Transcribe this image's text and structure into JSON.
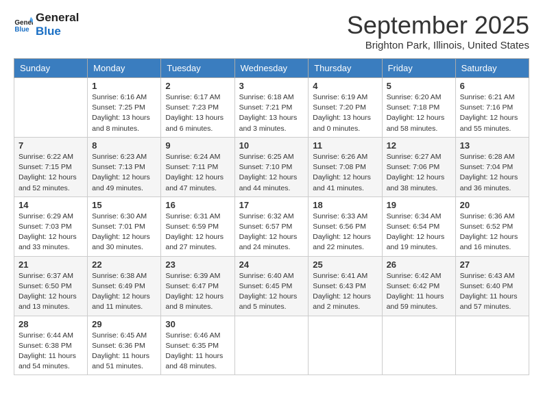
{
  "header": {
    "logo_line1": "General",
    "logo_line2": "Blue",
    "month": "September 2025",
    "location": "Brighton Park, Illinois, United States"
  },
  "weekdays": [
    "Sunday",
    "Monday",
    "Tuesday",
    "Wednesday",
    "Thursday",
    "Friday",
    "Saturday"
  ],
  "weeks": [
    [
      {
        "day": "",
        "sunrise": "",
        "sunset": "",
        "daylight": ""
      },
      {
        "day": "1",
        "sunrise": "Sunrise: 6:16 AM",
        "sunset": "Sunset: 7:25 PM",
        "daylight": "Daylight: 13 hours and 8 minutes."
      },
      {
        "day": "2",
        "sunrise": "Sunrise: 6:17 AM",
        "sunset": "Sunset: 7:23 PM",
        "daylight": "Daylight: 13 hours and 6 minutes."
      },
      {
        "day": "3",
        "sunrise": "Sunrise: 6:18 AM",
        "sunset": "Sunset: 7:21 PM",
        "daylight": "Daylight: 13 hours and 3 minutes."
      },
      {
        "day": "4",
        "sunrise": "Sunrise: 6:19 AM",
        "sunset": "Sunset: 7:20 PM",
        "daylight": "Daylight: 13 hours and 0 minutes."
      },
      {
        "day": "5",
        "sunrise": "Sunrise: 6:20 AM",
        "sunset": "Sunset: 7:18 PM",
        "daylight": "Daylight: 12 hours and 58 minutes."
      },
      {
        "day": "6",
        "sunrise": "Sunrise: 6:21 AM",
        "sunset": "Sunset: 7:16 PM",
        "daylight": "Daylight: 12 hours and 55 minutes."
      }
    ],
    [
      {
        "day": "7",
        "sunrise": "Sunrise: 6:22 AM",
        "sunset": "Sunset: 7:15 PM",
        "daylight": "Daylight: 12 hours and 52 minutes."
      },
      {
        "day": "8",
        "sunrise": "Sunrise: 6:23 AM",
        "sunset": "Sunset: 7:13 PM",
        "daylight": "Daylight: 12 hours and 49 minutes."
      },
      {
        "day": "9",
        "sunrise": "Sunrise: 6:24 AM",
        "sunset": "Sunset: 7:11 PM",
        "daylight": "Daylight: 12 hours and 47 minutes."
      },
      {
        "day": "10",
        "sunrise": "Sunrise: 6:25 AM",
        "sunset": "Sunset: 7:10 PM",
        "daylight": "Daylight: 12 hours and 44 minutes."
      },
      {
        "day": "11",
        "sunrise": "Sunrise: 6:26 AM",
        "sunset": "Sunset: 7:08 PM",
        "daylight": "Daylight: 12 hours and 41 minutes."
      },
      {
        "day": "12",
        "sunrise": "Sunrise: 6:27 AM",
        "sunset": "Sunset: 7:06 PM",
        "daylight": "Daylight: 12 hours and 38 minutes."
      },
      {
        "day": "13",
        "sunrise": "Sunrise: 6:28 AM",
        "sunset": "Sunset: 7:04 PM",
        "daylight": "Daylight: 12 hours and 36 minutes."
      }
    ],
    [
      {
        "day": "14",
        "sunrise": "Sunrise: 6:29 AM",
        "sunset": "Sunset: 7:03 PM",
        "daylight": "Daylight: 12 hours and 33 minutes."
      },
      {
        "day": "15",
        "sunrise": "Sunrise: 6:30 AM",
        "sunset": "Sunset: 7:01 PM",
        "daylight": "Daylight: 12 hours and 30 minutes."
      },
      {
        "day": "16",
        "sunrise": "Sunrise: 6:31 AM",
        "sunset": "Sunset: 6:59 PM",
        "daylight": "Daylight: 12 hours and 27 minutes."
      },
      {
        "day": "17",
        "sunrise": "Sunrise: 6:32 AM",
        "sunset": "Sunset: 6:57 PM",
        "daylight": "Daylight: 12 hours and 24 minutes."
      },
      {
        "day": "18",
        "sunrise": "Sunrise: 6:33 AM",
        "sunset": "Sunset: 6:56 PM",
        "daylight": "Daylight: 12 hours and 22 minutes."
      },
      {
        "day": "19",
        "sunrise": "Sunrise: 6:34 AM",
        "sunset": "Sunset: 6:54 PM",
        "daylight": "Daylight: 12 hours and 19 minutes."
      },
      {
        "day": "20",
        "sunrise": "Sunrise: 6:36 AM",
        "sunset": "Sunset: 6:52 PM",
        "daylight": "Daylight: 12 hours and 16 minutes."
      }
    ],
    [
      {
        "day": "21",
        "sunrise": "Sunrise: 6:37 AM",
        "sunset": "Sunset: 6:50 PM",
        "daylight": "Daylight: 12 hours and 13 minutes."
      },
      {
        "day": "22",
        "sunrise": "Sunrise: 6:38 AM",
        "sunset": "Sunset: 6:49 PM",
        "daylight": "Daylight: 12 hours and 11 minutes."
      },
      {
        "day": "23",
        "sunrise": "Sunrise: 6:39 AM",
        "sunset": "Sunset: 6:47 PM",
        "daylight": "Daylight: 12 hours and 8 minutes."
      },
      {
        "day": "24",
        "sunrise": "Sunrise: 6:40 AM",
        "sunset": "Sunset: 6:45 PM",
        "daylight": "Daylight: 12 hours and 5 minutes."
      },
      {
        "day": "25",
        "sunrise": "Sunrise: 6:41 AM",
        "sunset": "Sunset: 6:43 PM",
        "daylight": "Daylight: 12 hours and 2 minutes."
      },
      {
        "day": "26",
        "sunrise": "Sunrise: 6:42 AM",
        "sunset": "Sunset: 6:42 PM",
        "daylight": "Daylight: 11 hours and 59 minutes."
      },
      {
        "day": "27",
        "sunrise": "Sunrise: 6:43 AM",
        "sunset": "Sunset: 6:40 PM",
        "daylight": "Daylight: 11 hours and 57 minutes."
      }
    ],
    [
      {
        "day": "28",
        "sunrise": "Sunrise: 6:44 AM",
        "sunset": "Sunset: 6:38 PM",
        "daylight": "Daylight: 11 hours and 54 minutes."
      },
      {
        "day": "29",
        "sunrise": "Sunrise: 6:45 AM",
        "sunset": "Sunset: 6:36 PM",
        "daylight": "Daylight: 11 hours and 51 minutes."
      },
      {
        "day": "30",
        "sunrise": "Sunrise: 6:46 AM",
        "sunset": "Sunset: 6:35 PM",
        "daylight": "Daylight: 11 hours and 48 minutes."
      },
      {
        "day": "",
        "sunrise": "",
        "sunset": "",
        "daylight": ""
      },
      {
        "day": "",
        "sunrise": "",
        "sunset": "",
        "daylight": ""
      },
      {
        "day": "",
        "sunrise": "",
        "sunset": "",
        "daylight": ""
      },
      {
        "day": "",
        "sunrise": "",
        "sunset": "",
        "daylight": ""
      }
    ]
  ]
}
